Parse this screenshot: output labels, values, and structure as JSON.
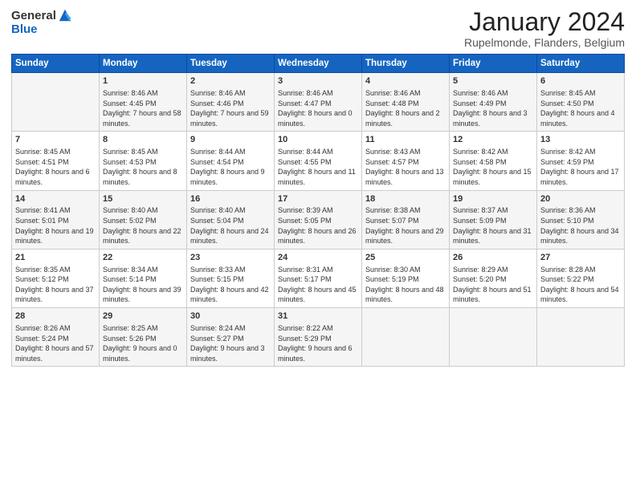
{
  "logo": {
    "general": "General",
    "blue": "Blue"
  },
  "header": {
    "title": "January 2024",
    "subtitle": "Rupelmonde, Flanders, Belgium"
  },
  "days_of_week": [
    "Sunday",
    "Monday",
    "Tuesday",
    "Wednesday",
    "Thursday",
    "Friday",
    "Saturday"
  ],
  "weeks": [
    [
      {
        "day": "",
        "sunrise": "",
        "sunset": "",
        "daylight": ""
      },
      {
        "day": "1",
        "sunrise": "Sunrise: 8:46 AM",
        "sunset": "Sunset: 4:45 PM",
        "daylight": "Daylight: 7 hours and 58 minutes."
      },
      {
        "day": "2",
        "sunrise": "Sunrise: 8:46 AM",
        "sunset": "Sunset: 4:46 PM",
        "daylight": "Daylight: 7 hours and 59 minutes."
      },
      {
        "day": "3",
        "sunrise": "Sunrise: 8:46 AM",
        "sunset": "Sunset: 4:47 PM",
        "daylight": "Daylight: 8 hours and 0 minutes."
      },
      {
        "day": "4",
        "sunrise": "Sunrise: 8:46 AM",
        "sunset": "Sunset: 4:48 PM",
        "daylight": "Daylight: 8 hours and 2 minutes."
      },
      {
        "day": "5",
        "sunrise": "Sunrise: 8:46 AM",
        "sunset": "Sunset: 4:49 PM",
        "daylight": "Daylight: 8 hours and 3 minutes."
      },
      {
        "day": "6",
        "sunrise": "Sunrise: 8:45 AM",
        "sunset": "Sunset: 4:50 PM",
        "daylight": "Daylight: 8 hours and 4 minutes."
      }
    ],
    [
      {
        "day": "7",
        "sunrise": "Sunrise: 8:45 AM",
        "sunset": "Sunset: 4:51 PM",
        "daylight": "Daylight: 8 hours and 6 minutes."
      },
      {
        "day": "8",
        "sunrise": "Sunrise: 8:45 AM",
        "sunset": "Sunset: 4:53 PM",
        "daylight": "Daylight: 8 hours and 8 minutes."
      },
      {
        "day": "9",
        "sunrise": "Sunrise: 8:44 AM",
        "sunset": "Sunset: 4:54 PM",
        "daylight": "Daylight: 8 hours and 9 minutes."
      },
      {
        "day": "10",
        "sunrise": "Sunrise: 8:44 AM",
        "sunset": "Sunset: 4:55 PM",
        "daylight": "Daylight: 8 hours and 11 minutes."
      },
      {
        "day": "11",
        "sunrise": "Sunrise: 8:43 AM",
        "sunset": "Sunset: 4:57 PM",
        "daylight": "Daylight: 8 hours and 13 minutes."
      },
      {
        "day": "12",
        "sunrise": "Sunrise: 8:42 AM",
        "sunset": "Sunset: 4:58 PM",
        "daylight": "Daylight: 8 hours and 15 minutes."
      },
      {
        "day": "13",
        "sunrise": "Sunrise: 8:42 AM",
        "sunset": "Sunset: 4:59 PM",
        "daylight": "Daylight: 8 hours and 17 minutes."
      }
    ],
    [
      {
        "day": "14",
        "sunrise": "Sunrise: 8:41 AM",
        "sunset": "Sunset: 5:01 PM",
        "daylight": "Daylight: 8 hours and 19 minutes."
      },
      {
        "day": "15",
        "sunrise": "Sunrise: 8:40 AM",
        "sunset": "Sunset: 5:02 PM",
        "daylight": "Daylight: 8 hours and 22 minutes."
      },
      {
        "day": "16",
        "sunrise": "Sunrise: 8:40 AM",
        "sunset": "Sunset: 5:04 PM",
        "daylight": "Daylight: 8 hours and 24 minutes."
      },
      {
        "day": "17",
        "sunrise": "Sunrise: 8:39 AM",
        "sunset": "Sunset: 5:05 PM",
        "daylight": "Daylight: 8 hours and 26 minutes."
      },
      {
        "day": "18",
        "sunrise": "Sunrise: 8:38 AM",
        "sunset": "Sunset: 5:07 PM",
        "daylight": "Daylight: 8 hours and 29 minutes."
      },
      {
        "day": "19",
        "sunrise": "Sunrise: 8:37 AM",
        "sunset": "Sunset: 5:09 PM",
        "daylight": "Daylight: 8 hours and 31 minutes."
      },
      {
        "day": "20",
        "sunrise": "Sunrise: 8:36 AM",
        "sunset": "Sunset: 5:10 PM",
        "daylight": "Daylight: 8 hours and 34 minutes."
      }
    ],
    [
      {
        "day": "21",
        "sunrise": "Sunrise: 8:35 AM",
        "sunset": "Sunset: 5:12 PM",
        "daylight": "Daylight: 8 hours and 37 minutes."
      },
      {
        "day": "22",
        "sunrise": "Sunrise: 8:34 AM",
        "sunset": "Sunset: 5:14 PM",
        "daylight": "Daylight: 8 hours and 39 minutes."
      },
      {
        "day": "23",
        "sunrise": "Sunrise: 8:33 AM",
        "sunset": "Sunset: 5:15 PM",
        "daylight": "Daylight: 8 hours and 42 minutes."
      },
      {
        "day": "24",
        "sunrise": "Sunrise: 8:31 AM",
        "sunset": "Sunset: 5:17 PM",
        "daylight": "Daylight: 8 hours and 45 minutes."
      },
      {
        "day": "25",
        "sunrise": "Sunrise: 8:30 AM",
        "sunset": "Sunset: 5:19 PM",
        "daylight": "Daylight: 8 hours and 48 minutes."
      },
      {
        "day": "26",
        "sunrise": "Sunrise: 8:29 AM",
        "sunset": "Sunset: 5:20 PM",
        "daylight": "Daylight: 8 hours and 51 minutes."
      },
      {
        "day": "27",
        "sunrise": "Sunrise: 8:28 AM",
        "sunset": "Sunset: 5:22 PM",
        "daylight": "Daylight: 8 hours and 54 minutes."
      }
    ],
    [
      {
        "day": "28",
        "sunrise": "Sunrise: 8:26 AM",
        "sunset": "Sunset: 5:24 PM",
        "daylight": "Daylight: 8 hours and 57 minutes."
      },
      {
        "day": "29",
        "sunrise": "Sunrise: 8:25 AM",
        "sunset": "Sunset: 5:26 PM",
        "daylight": "Daylight: 9 hours and 0 minutes."
      },
      {
        "day": "30",
        "sunrise": "Sunrise: 8:24 AM",
        "sunset": "Sunset: 5:27 PM",
        "daylight": "Daylight: 9 hours and 3 minutes."
      },
      {
        "day": "31",
        "sunrise": "Sunrise: 8:22 AM",
        "sunset": "Sunset: 5:29 PM",
        "daylight": "Daylight: 9 hours and 6 minutes."
      },
      {
        "day": "",
        "sunrise": "",
        "sunset": "",
        "daylight": ""
      },
      {
        "day": "",
        "sunrise": "",
        "sunset": "",
        "daylight": ""
      },
      {
        "day": "",
        "sunrise": "",
        "sunset": "",
        "daylight": ""
      }
    ]
  ]
}
